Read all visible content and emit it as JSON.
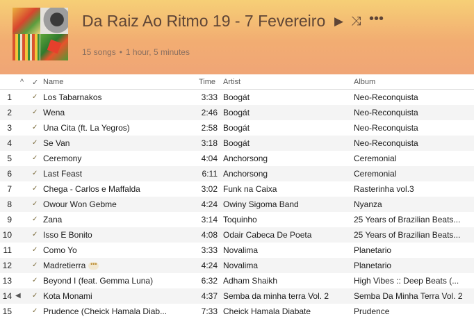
{
  "playlist": {
    "title": "Da Raiz Ao Ritmo 19 - 7 Fevereiro",
    "song_count": "15 songs",
    "duration": "1 hour, 5 minutes",
    "separator": "•"
  },
  "columns": {
    "sort_arrow": "^",
    "check": "✓",
    "name": "Name",
    "time": "Time",
    "artist": "Artist",
    "album": "Album"
  },
  "icons": {
    "play": "▶",
    "shuffle": "⤨",
    "more": "•••",
    "playing_speaker": "◀",
    "checkmark": "✓",
    "row_more": "•••"
  },
  "tracks": [
    {
      "num": "1",
      "name": "Los Tabarnakos",
      "time": "3:33",
      "artist": "Boogát",
      "album": "Neo-Reconquista"
    },
    {
      "num": "2",
      "name": "Wena",
      "time": "2:46",
      "artist": "Boogát",
      "album": "Neo-Reconquista"
    },
    {
      "num": "3",
      "name": "Una Cita (ft. La Yegros)",
      "time": "2:58",
      "artist": "Boogát",
      "album": "Neo-Reconquista"
    },
    {
      "num": "4",
      "name": "Se Van",
      "time": "3:18",
      "artist": "Boogát",
      "album": "Neo-Reconquista"
    },
    {
      "num": "5",
      "name": "Ceremony",
      "time": "4:04",
      "artist": "Anchorsong",
      "album": "Ceremonial"
    },
    {
      "num": "6",
      "name": "Last Feast",
      "time": "6:11",
      "artist": "Anchorsong",
      "album": "Ceremonial"
    },
    {
      "num": "7",
      "name": "Chega - Carlos e Maffalda",
      "time": "3:02",
      "artist": "Funk na Caixa",
      "album": "Rasterinha vol.3"
    },
    {
      "num": "8",
      "name": "Owour Won Gebme",
      "time": "4:24",
      "artist": "Owiny Sigoma Band",
      "album": "Nyanza"
    },
    {
      "num": "9",
      "name": "Zana",
      "time": "3:14",
      "artist": "Toquinho",
      "album": "25 Years of Brazilian Beats..."
    },
    {
      "num": "10",
      "name": "Isso E Bonito",
      "time": "4:08",
      "artist": "Odair Cabeca De Poeta",
      "album": "25 Years of Brazilian Beats..."
    },
    {
      "num": "11",
      "name": "Como Yo",
      "time": "3:33",
      "artist": "Novalima",
      "album": "Planetario"
    },
    {
      "num": "12",
      "name": "Madretierra",
      "time": "4:24",
      "artist": "Novalima",
      "album": "Planetario"
    },
    {
      "num": "13",
      "name": "Beyond I (feat. Gemma Luna)",
      "time": "6:32",
      "artist": "Adham Shaikh",
      "album": "High Vibes :: Deep Beats (..."
    },
    {
      "num": "14",
      "name": "Kota Monami",
      "time": "4:37",
      "artist": "Semba da minha terra Vol. 2",
      "album": "Semba Da Minha Terra Vol. 2"
    },
    {
      "num": "15",
      "name": "Prudence (Cheick Hamala Diab...",
      "time": "7:33",
      "artist": "Cheick Hamala Diabate",
      "album": "Prudence"
    }
  ]
}
